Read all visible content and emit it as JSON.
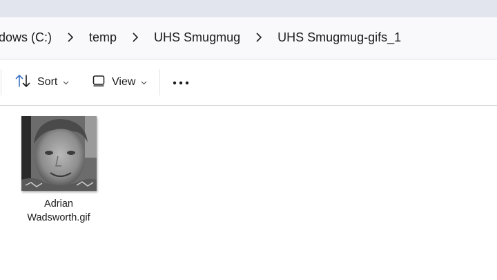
{
  "breadcrumb": {
    "items": [
      "dows  (C:)",
      "temp",
      "UHS Smugmug",
      "UHS Smugmug-gifs_1"
    ]
  },
  "toolbar": {
    "sort_label": "Sort",
    "view_label": "View"
  },
  "files": [
    {
      "name_line1": "Adrian",
      "name_line2": "Wadsworth.gif",
      "thumbnail": "grayscale photo of smiling boy"
    }
  ],
  "colors": {
    "accent": "#3a74c4",
    "address_bg": "#f9f9fb",
    "title_strip": "#e2e5ee"
  }
}
